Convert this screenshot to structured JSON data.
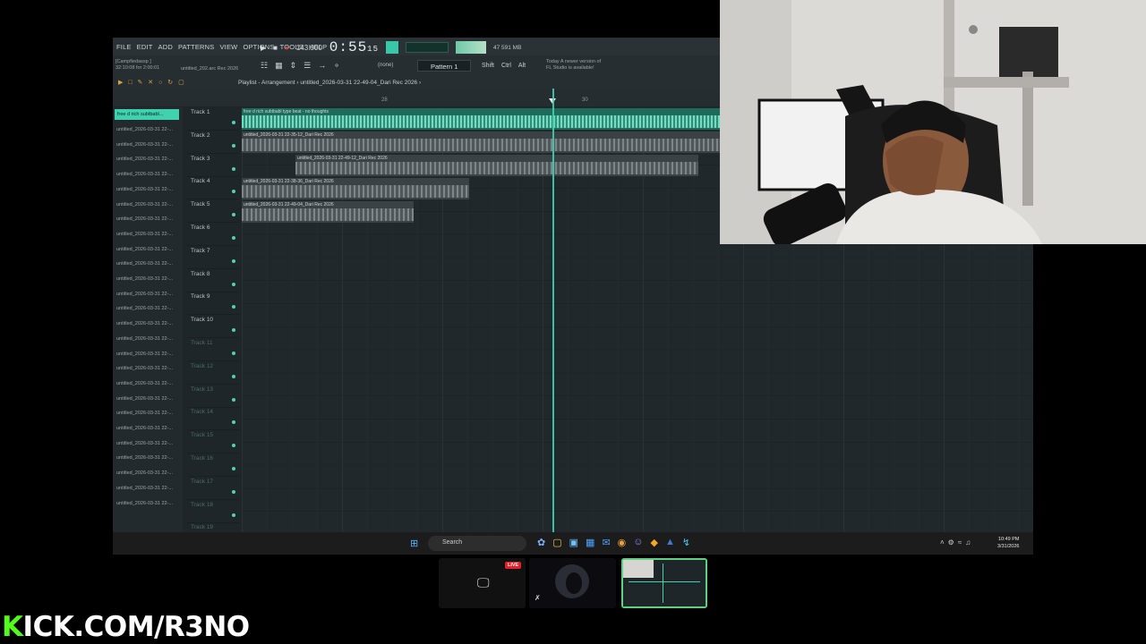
{
  "fl": {
    "menu": [
      "FILE",
      "EDIT",
      "ADD",
      "PATTERNS",
      "VIEW",
      "OPTIONS",
      "TOOLS",
      "HELP"
    ],
    "tempo": "143.000",
    "time": "0:55",
    "time_small": "15",
    "memory": "591 MB",
    "cpu_num": "47",
    "project_info": "[Campfiedassp ]",
    "project_time": "32:10:08 for 2:00:01",
    "project_name": "untitled_202.arc Rec 2026",
    "pattern": "Pattern 1",
    "none_label": "(none)",
    "mod_keys": [
      "Shift",
      "Ctrl",
      "Alt"
    ],
    "update_note_1": "Today  A newer version of",
    "update_note_2": "FL Studio is available!",
    "playlist_title": "Playlist - Arrangement  › untitled_2026-03-31 22-49-04_Dari Rec 2026 ›",
    "bar_28": "28",
    "bar_30": "30"
  },
  "picker": {
    "head": "free d rich  subtbabl...",
    "items": [
      "untitled_2026-03-31 22-...",
      "untitled_2026-03-31 22-...",
      "untitled_2026-03-31 22-...",
      "untitled_2026-03-31 22-...",
      "untitled_2026-03-31 22-...",
      "untitled_2026-03-31 22-...",
      "untitled_2026-03-31 22-...",
      "untitled_2026-03-31 22-...",
      "untitled_2026-03-31 22-...",
      "untitled_2026-03-31 22-...",
      "untitled_2026-03-31 22-...",
      "untitled_2026-03-31 22-...",
      "untitled_2026-03-31 22-...",
      "untitled_2026-03-31 22-...",
      "untitled_2026-03-31 22-...",
      "untitled_2026-03-31 22-...",
      "untitled_2026-03-31 22-...",
      "untitled_2026-03-31 22-...",
      "untitled_2026-03-31 22-...",
      "untitled_2026-03-31 22-...",
      "untitled_2026-03-31 22-...",
      "untitled_2026-03-31 22-...",
      "untitled_2026-03-31 22-...",
      "untitled_2026-03-31 22-...",
      "untitled_2026-03-31 22-...",
      "untitled_2026-03-31 22-..."
    ]
  },
  "tracks": [
    {
      "label": "Track 1",
      "dim": false
    },
    {
      "label": "Track 2",
      "dim": false
    },
    {
      "label": "Track 3",
      "dim": false
    },
    {
      "label": "Track 4",
      "dim": false
    },
    {
      "label": "Track 5",
      "dim": false
    },
    {
      "label": "Track 6",
      "dim": false
    },
    {
      "label": "Track 7",
      "dim": false
    },
    {
      "label": "Track 8",
      "dim": false
    },
    {
      "label": "Track 9",
      "dim": false
    },
    {
      "label": "Track 10",
      "dim": false
    },
    {
      "label": "Track 11",
      "dim": true
    },
    {
      "label": "Track 12",
      "dim": true
    },
    {
      "label": "Track 13",
      "dim": true
    },
    {
      "label": "Track 14",
      "dim": true
    },
    {
      "label": "Track 15",
      "dim": true
    },
    {
      "label": "Track 16",
      "dim": true
    },
    {
      "label": "Track 17",
      "dim": true
    },
    {
      "label": "Track 18",
      "dim": true
    },
    {
      "label": "Track 19",
      "dim": true
    }
  ],
  "clips": [
    {
      "label": "free d rich  subtbabl type beat - no thoughts",
      "style": "green"
    },
    {
      "label": "untitled_2026-03-31 22-35-12_Dari Rec 2026",
      "style": "gray"
    },
    {
      "label": "untitled_2026-03-31 22-49-12_Dari Rec 2026",
      "style": "gray"
    },
    {
      "label": "untitled_2026-03-31 22-38-36_Dari Rec 2026",
      "style": "gray"
    },
    {
      "label": "untitled_2026-03-31 22-49-04_Dari Rec 2026",
      "style": "gray"
    }
  ],
  "taskbar": {
    "search_placeholder": "Search",
    "clock_time": "10:49 PM",
    "clock_date": "3/31/2026"
  },
  "stream": {
    "live": "LIVE",
    "brand_k": "K",
    "brand_rest": "ICK.COM/R3NO"
  }
}
